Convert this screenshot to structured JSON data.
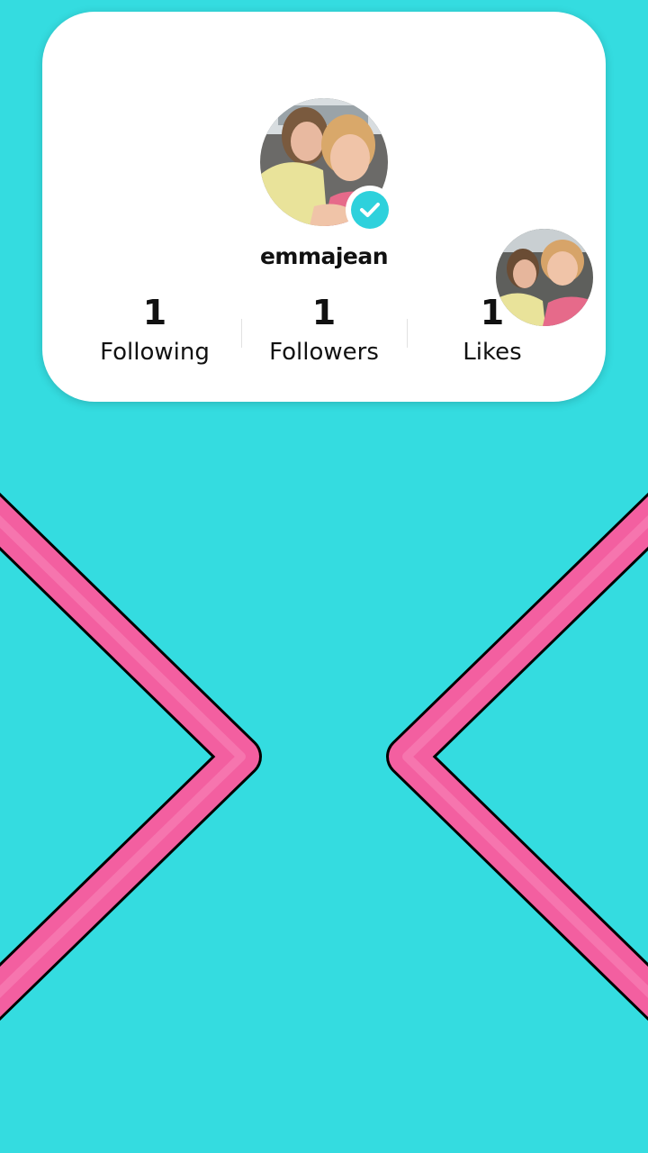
{
  "profile": {
    "username": "emmajean",
    "verified": true,
    "avatar_icon": "profile-photo-two-girls",
    "badge_icon": "verified-check-icon"
  },
  "stats": [
    {
      "value": "1",
      "label": "Following"
    },
    {
      "value": "1",
      "label": "Followers"
    },
    {
      "value": "1",
      "label": "Likes"
    }
  ],
  "colors": {
    "background": "#34dce0",
    "card": "#ffffff",
    "accent": "#2ed1dc",
    "chevron": "#f35fa0"
  }
}
